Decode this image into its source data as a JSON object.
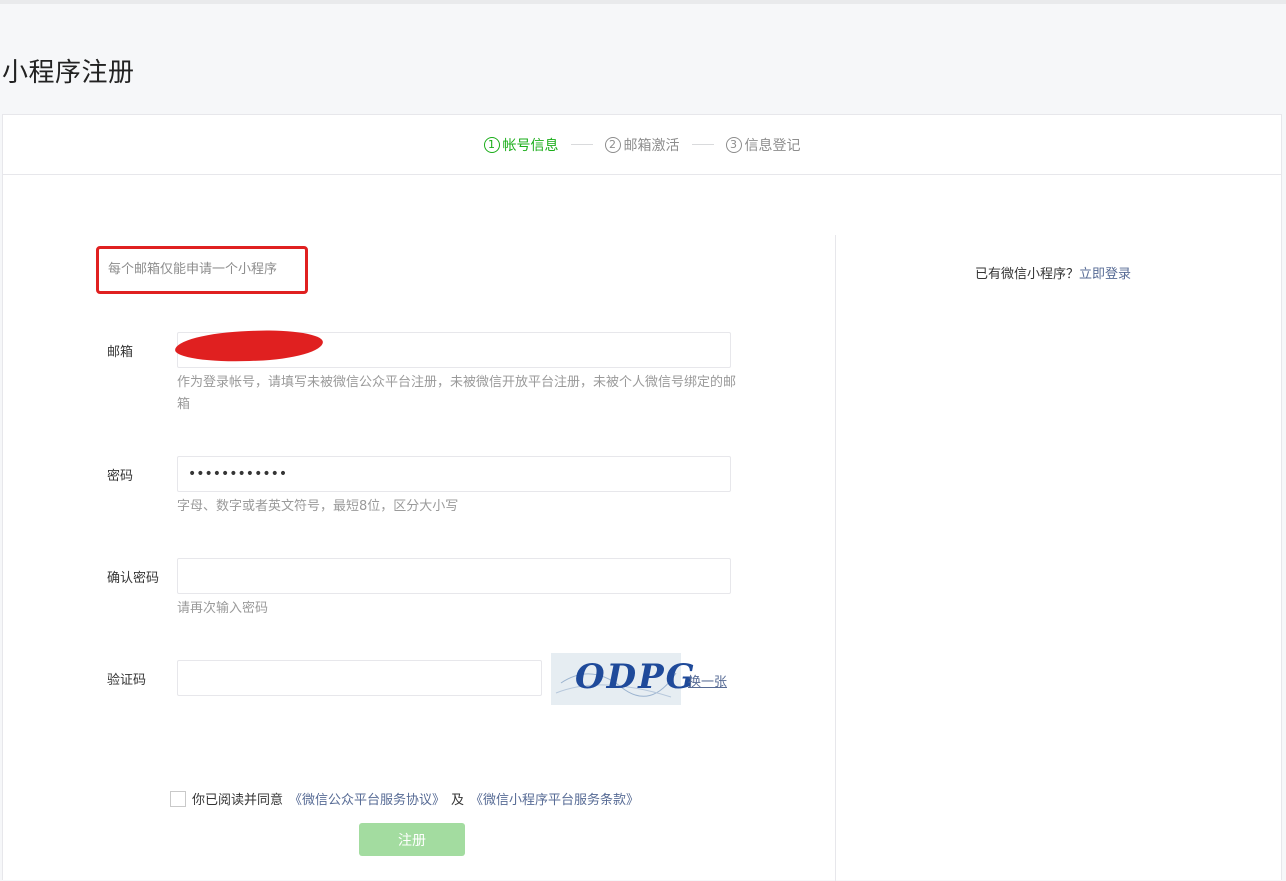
{
  "page": {
    "title": "小程序注册"
  },
  "steps": [
    {
      "num": "1",
      "label": "帐号信息"
    },
    {
      "num": "2",
      "label": "邮箱激活"
    },
    {
      "num": "3",
      "label": "信息登记"
    }
  ],
  "notice": "每个邮箱仅能申请一个小程序",
  "login": {
    "prompt": "已有微信小程序？",
    "link": "立即登录"
  },
  "form": {
    "email": {
      "label": "邮箱",
      "value": "",
      "hint": "作为登录帐号，请填写未被微信公众平台注册，未被微信开放平台注册，未被个人微信号绑定的邮箱"
    },
    "password": {
      "label": "密码",
      "value": "••••••••••••",
      "hint": "字母、数字或者英文符号，最短8位，区分大小写"
    },
    "confirm": {
      "label": "确认密码",
      "value": "",
      "hint": "请再次输入密码"
    },
    "captcha": {
      "label": "验证码",
      "value": "",
      "image_text": "ODPG",
      "refresh": "换一张"
    }
  },
  "agreement": {
    "prefix": "你已阅读并同意",
    "link1": "《微信公众平台服务协议》",
    "mid": "及",
    "link2": "《微信小程序平台服务条款》",
    "checked": false
  },
  "submit": "注册",
  "colors": {
    "accent": "#1aad19",
    "link": "#576b95",
    "button_disabled": "#a3dca0",
    "highlight_border": "#e02020"
  }
}
